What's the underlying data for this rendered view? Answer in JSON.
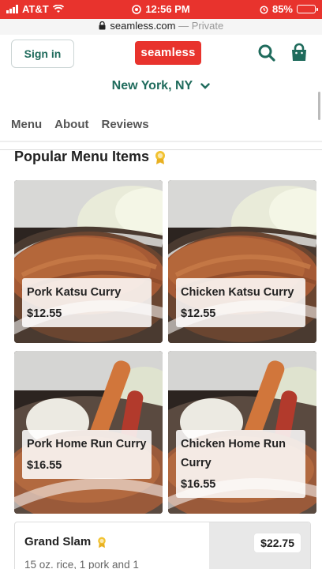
{
  "status_bar": {
    "carrier": "AT&T",
    "time": "12:56 PM",
    "battery": "85%",
    "battery_level": 0.85
  },
  "url_bar": {
    "domain": "seamless.com",
    "separator": "—",
    "mode": "Private"
  },
  "header": {
    "signin_label": "Sign in",
    "logo_text": "seamless",
    "location": "New York, NY",
    "icons": [
      "search-icon",
      "bag-icon",
      "chevron-down-icon"
    ],
    "accent": "#1f6b5c",
    "brand": "#e8332d"
  },
  "tabs": [
    "Menu",
    "About",
    "Reviews"
  ],
  "popular": {
    "title": "Popular Menu Items",
    "badge_icon": "award-icon",
    "items": [
      {
        "name": "Pork Katsu Curry",
        "price": "$12.55"
      },
      {
        "name": "Chicken Katsu Curry",
        "price": "$12.55"
      },
      {
        "name": "Pork Home Run Curry",
        "price": "$16.55"
      },
      {
        "name": "Chicken Home Run Curry",
        "price": "$16.55"
      }
    ]
  },
  "menu_item": {
    "name": "Grand Slam",
    "price": "$22.75",
    "description": "15 oz. rice, 1 pork and 1"
  }
}
